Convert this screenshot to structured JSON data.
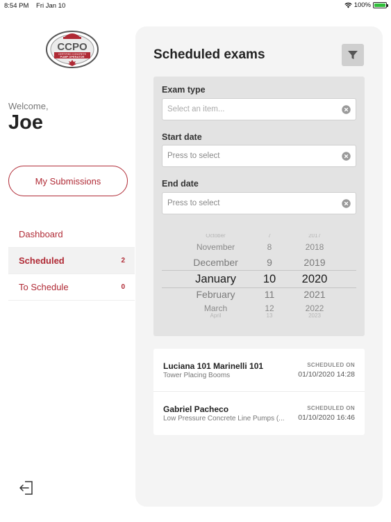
{
  "status_bar": {
    "time": "8:54 PM",
    "date": "Fri Jan 10",
    "battery_text": "100%",
    "battery_level": 1.0
  },
  "logo": {
    "top_text": "CCPO",
    "sub_text": "CERTIFIED CONCRETE",
    "sub_text2": "PUMP OPERATOR"
  },
  "sidebar": {
    "welcome": "Welcome,",
    "user": "Joe",
    "submissions_button": "My Submissions",
    "items": [
      {
        "label": "Dashboard",
        "count": ""
      },
      {
        "label": "Scheduled",
        "count": "2"
      },
      {
        "label": "To Schedule",
        "count": "0"
      }
    ]
  },
  "main": {
    "title": "Scheduled exams",
    "filters": {
      "exam_type_label": "Exam type",
      "exam_type_placeholder": "Select an item...",
      "start_date_label": "Start date",
      "start_date_placeholder": "Press to select",
      "end_date_label": "End date",
      "end_date_placeholder": "Press to select"
    },
    "picker": {
      "months": [
        "October",
        "November",
        "December",
        "January",
        "February",
        "March",
        "April"
      ],
      "days": [
        "7",
        "8",
        "9",
        "10",
        "11",
        "12",
        "13"
      ],
      "years": [
        "2017",
        "2018",
        "2019",
        "2020",
        "2021",
        "2022",
        "2023"
      ],
      "selected_index": 3
    },
    "exams": [
      {
        "name": "Luciana 101 Marinelli 101",
        "type": "Tower Placing Booms",
        "scheduled_label": "SCHEDULED ON",
        "scheduled_on": "01/10/2020 14:28"
      },
      {
        "name": "Gabriel Pacheco",
        "type": "Low Pressure Concrete Line Pumps (...",
        "scheduled_label": "SCHEDULED ON",
        "scheduled_on": "01/10/2020 16:46"
      }
    ]
  },
  "colors": {
    "accent": "#b02a35",
    "panel_bg": "#f4f4f4",
    "filter_bg": "#e3e3e3"
  }
}
